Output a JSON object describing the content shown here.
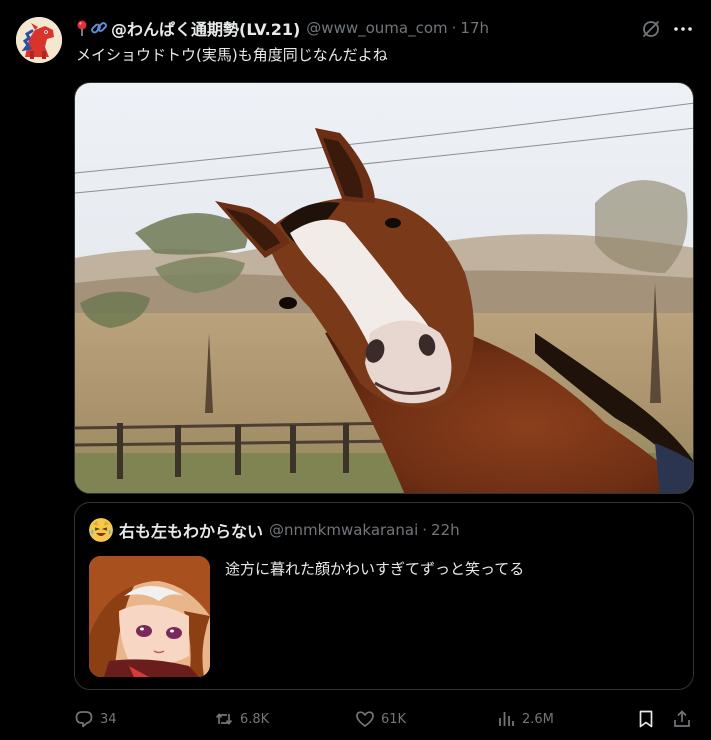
{
  "post": {
    "display_name": "@わんぱく通期勢(LV.21)",
    "handle": "@www_ouma_com",
    "separator": "·",
    "time": "17h",
    "text": "メイショウドトウ(実馬)も角度同じなんだよね",
    "header_icons": [
      "pushpin-icon",
      "link-icon"
    ],
    "menu_icons": [
      "grok-icon",
      "more-icon"
    ]
  },
  "quote": {
    "display_name": "右も左もわからない",
    "handle": "@nnmkmwakaranai",
    "separator": "·",
    "time": "22h",
    "text": "途方に暮れた顔かわいすぎてずっと笑ってる"
  },
  "actions": {
    "replies": "34",
    "reposts": "6.8K",
    "likes": "61K",
    "views": "2.6M"
  },
  "colors": {
    "background": "#000000",
    "text_primary": "#e7e9ea",
    "text_secondary": "#71767b",
    "border": "#2f3336"
  }
}
